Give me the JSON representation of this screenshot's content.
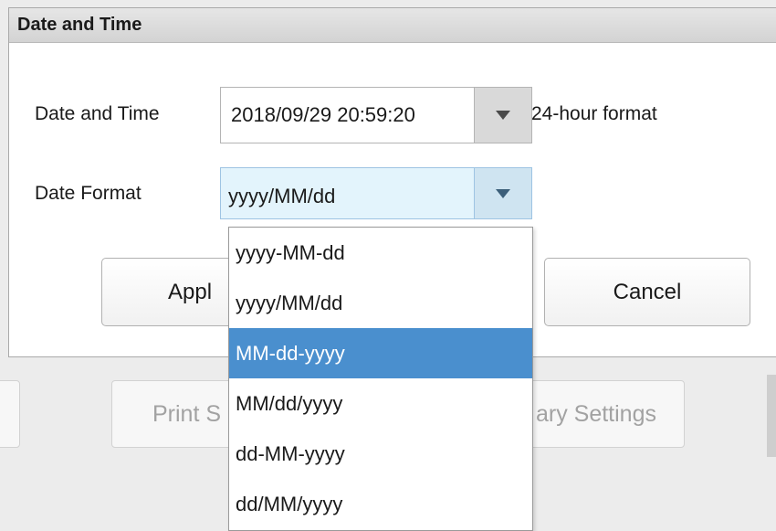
{
  "background": {
    "print_button_label": "Print S",
    "secondary_button_label": "ary Settings"
  },
  "dialog": {
    "title": "Date and Time",
    "date_time_label": "Date and Time",
    "date_time_value": "2018/09/29 20:59:20",
    "date_time_suffix": "24-hour format",
    "date_format_label": "Date Format",
    "date_format_value": "yyyy/MM/dd",
    "apply_label": "Appl",
    "cancel_label": "Cancel"
  },
  "dropdown": {
    "options": [
      {
        "label": "yyyy-MM-dd",
        "selected": false
      },
      {
        "label": "yyyy/MM/dd",
        "selected": false
      },
      {
        "label": "MM-dd-yyyy",
        "selected": true
      },
      {
        "label": "MM/dd/yyyy",
        "selected": false
      },
      {
        "label": "dd-MM-yyyy",
        "selected": false
      },
      {
        "label": "dd/MM/yyyy",
        "selected": false
      }
    ]
  },
  "colors": {
    "highlight": "#4a8fce",
    "combo_active_bg": "#e3f4fc",
    "title_bar": "#d9d9d9"
  },
  "icons": {
    "combo_arrow": "chevron-down-icon"
  }
}
